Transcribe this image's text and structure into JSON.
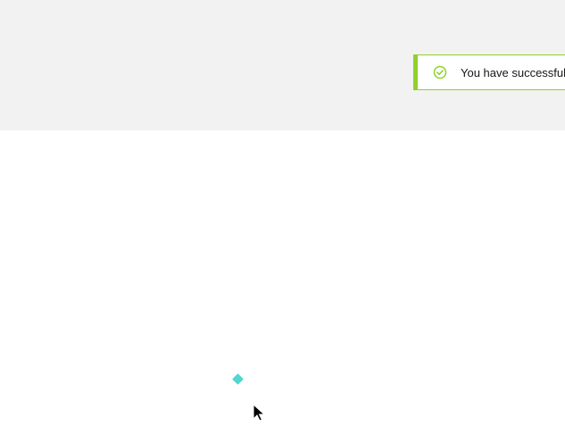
{
  "notification": {
    "message": "You have successfully",
    "status_icon": "check-circle-icon",
    "accent_color": "#8fd12a"
  },
  "background": {
    "top_band_color": "#f2f2f2",
    "main_color": "#ffffff"
  },
  "decorations": {
    "marker_color": "#4fd8d1",
    "marker_icon": "diamond-marker-icon",
    "cursor_icon": "mouse-pointer-icon"
  }
}
